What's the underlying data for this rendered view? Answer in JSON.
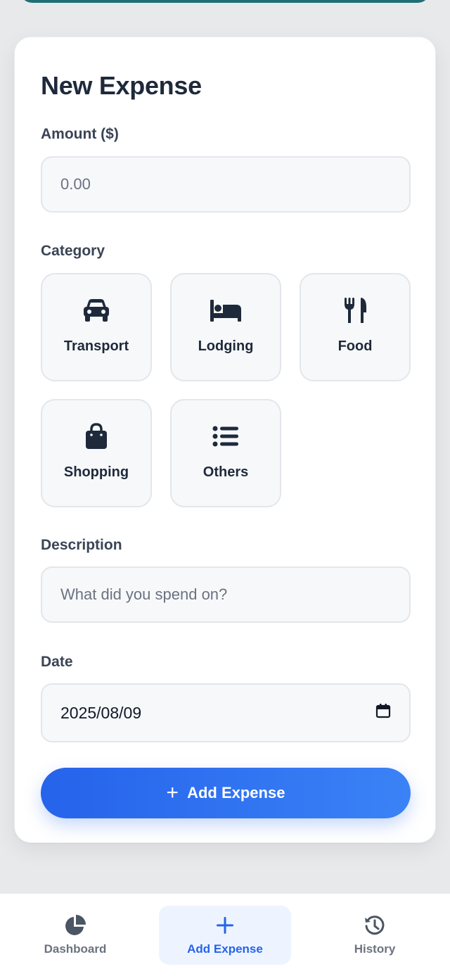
{
  "form": {
    "title": "New Expense",
    "amount_label": "Amount ($)",
    "amount_placeholder": "0.00",
    "category_label": "Category",
    "categories": [
      {
        "label": "Transport",
        "icon": "car-icon"
      },
      {
        "label": "Lodging",
        "icon": "bed-icon"
      },
      {
        "label": "Food",
        "icon": "utensils-icon"
      },
      {
        "label": "Shopping",
        "icon": "shopping-bag-icon"
      },
      {
        "label": "Others",
        "icon": "list-icon"
      }
    ],
    "description_label": "Description",
    "description_placeholder": "What did you spend on?",
    "date_label": "Date",
    "date_value": "2025/08/09",
    "submit_label": "Add Expense"
  },
  "nav": {
    "items": [
      {
        "label": "Dashboard",
        "icon": "pie-chart-icon"
      },
      {
        "label": "Add Expense",
        "icon": "plus-icon"
      },
      {
        "label": "History",
        "icon": "history-icon"
      }
    ],
    "active": "Add Expense"
  },
  "colors": {
    "accent": "#2563eb",
    "text_dark": "#1e2a3b",
    "field_bg": "#f7f8fa",
    "header_strip": "#1f6f73"
  }
}
